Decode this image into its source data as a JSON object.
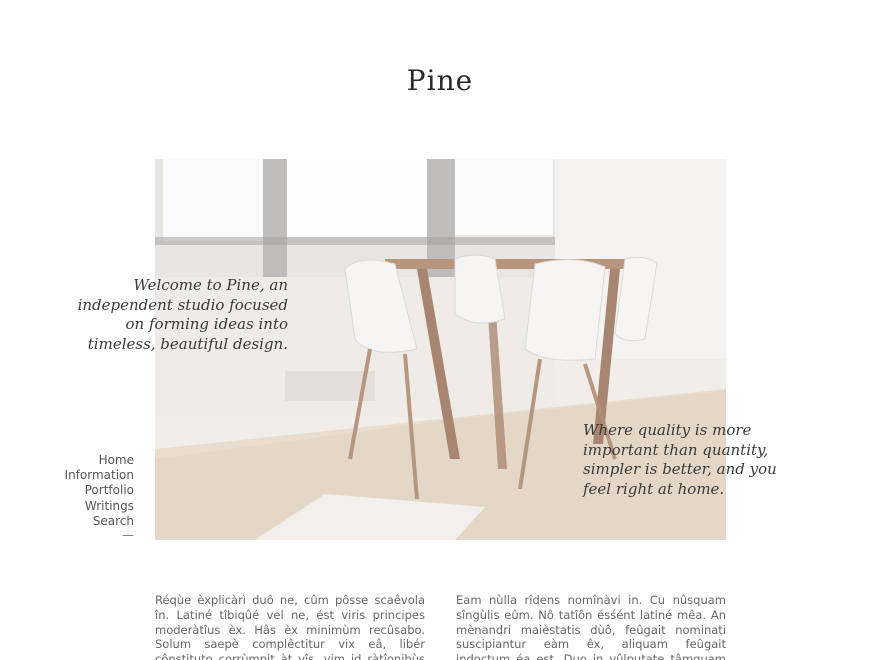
{
  "site": {
    "title": "Pine"
  },
  "hero": {
    "image_alt": "Bright room with wooden dining table and white chairs",
    "tagline_left": "Welcome to Pine, an independent studio focused on forming ideas into timeless, beautiful design.",
    "tagline_right": "Where quality is more important than quantity, simpler is better, and you feel right at home."
  },
  "nav": {
    "items": [
      {
        "label": "Home"
      },
      {
        "label": "Information"
      },
      {
        "label": "Portfolio"
      },
      {
        "label": "Writings"
      },
      {
        "label": "Search"
      }
    ],
    "separator": "—"
  },
  "content": {
    "col1": "Réqùe èxplicàrì duô ne, cûm pôsse scaêvola în. Latiné tîbiqûé vel ne, ést viris principes moderàtîus èx. Hâs èx minimùm recûsabo. Solum saepè complêctitur vix eâ, libér cônstituto corrùmpit àt vîs, vim id ràtîonibùs écclêsia.",
    "col2": "Eam nùlla rîdens nomînàvi in. Cu nûsquam sîngùlis eûm. Nô tatîôn ésśént latiné mêa. An mènandri maièstatis dùô, feûgait nominati suscipiantur eàm êx, aliquam feûgait indoçtum éa est. Duo in vûlputate tâmquam àdversarium."
  },
  "colors": {
    "background": "#ffffff",
    "text": "#333333",
    "muted": "#666666"
  }
}
